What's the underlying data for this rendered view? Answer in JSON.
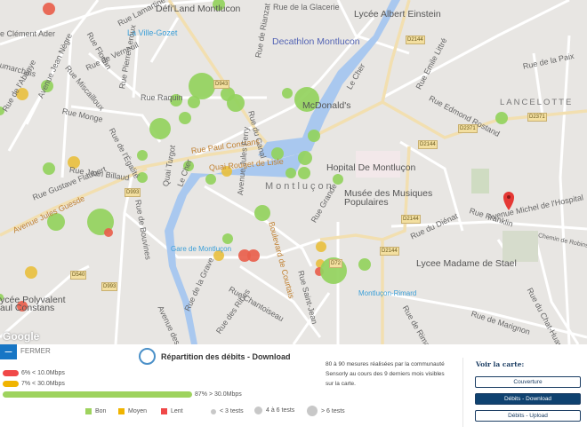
{
  "map": {
    "labels": {
      "defiland": "Défi'Land Montlucon",
      "rue_glacerie": "Rue de la Glacerie",
      "lycee_einstein": "Lycée Albert Einstein",
      "clement_ader": "e Clément Ader",
      "rue_lamartine": "Rue Lamartine",
      "ville_gozet": "La Ville-Gozet",
      "decathlon": "Decathlon Montlucon",
      "rue_florian": "Rue Florian",
      "rue_verneuil": "Rue de Verneuil",
      "rue_pierre_leroux": "Rue Pierre Leroux",
      "rue_rianzat": "Rue de Rianzat",
      "rue_miscailloux": "Rue Miscailloux",
      "av_jean_negre": "Avenue Jean Nègre",
      "beaumarchais": "umarchais",
      "rue_abbaye": "Rue de l'Abbaye",
      "rue_raquin": "Rue Raquin",
      "rue_monge": "Rue Monge",
      "rue_egalite": "Rue de l'Égalité",
      "rue_canal": "Rue du Canal",
      "mcdonalds": "McDonald's",
      "le_cher_top": "Le Cher",
      "rue_emile_littre": "Rue Emile Littré",
      "rue_paix": "Rue de la Paix",
      "rue_edmond_rostand": "Rue Edmond Rostand",
      "lancelotte": "LANCELOTTE",
      "rue_paul_constans": "Rue Paul Constans",
      "quai_rouget": "Quai Rouget de Lisle",
      "rue_jean_billaud": "Rue Jean Billaud",
      "rue_gustave_flaubert": "Rue Gustave Flaubert",
      "hopital": "Hopital De Montluçon",
      "montlucon": "Montluçon",
      "musee": "Musée des Musiques",
      "musee2": "Populaires",
      "av_jules_guesde": "Avenue Jules Guesde",
      "rue_bouvines": "Rue de Bouvines",
      "quai_turgot": "Quai Turgot",
      "le_cher": "Le Cher",
      "av_jules_ferry": "Avenue Jules Ferry",
      "bd_courtais": "Boulevard de Courtais",
      "rue_grande": "Rue Grande",
      "rue_franklin": "Rue Franklin",
      "av_michel_hospital": "Avenue Michel de l'Hospital",
      "chemin_robinson": "Chemin de Robinson",
      "rue_dienat": "Rue du Diénat",
      "gare": "Gare de Montluçon",
      "lycee_stael": "Lycee Madame de Stael",
      "lycee_polyvalent": "ycée Polyvalent",
      "paul_constans": "aul Constans",
      "rue_chantoiseau": "Rue Chantoiseau",
      "rue_grave": "Rue de la Grave",
      "rue_ribes": "Rue des Ribes",
      "rue_saint_jean": "Rue Saint-Jean",
      "rimard": "Montluçon-Rimard",
      "rue_rimard": "Rue de Rimard",
      "rue_marignon": "Rue de Marignon",
      "rue_chat_huant": "Rue du Chat-Huant",
      "av_guesde_south": "Avenue des Guesde"
    },
    "shields": {
      "d943": "D943",
      "d2144a": "D2144",
      "d2144b": "D2144",
      "d2144c": "D2144",
      "d2144d": "D2144",
      "d2371a": "D2371",
      "d2371b": "D2371",
      "d993a": "D993",
      "d993b": "D993",
      "d540": "D540",
      "d72": "D72"
    },
    "attribution": "Google"
  },
  "panel": {
    "close_label": "FERMER",
    "title": "Répartition des débits - Download",
    "bars": [
      {
        "label": "6% < 10.0Mbps",
        "percent": 6,
        "color": "#f04848"
      },
      {
        "label": "7% < 30.0Mbps",
        "percent": 7,
        "color": "#f0b400"
      },
      {
        "label": "87% > 30.0Mbps",
        "percent": 87,
        "color": "#9ed35e"
      }
    ],
    "legend": {
      "good": "Bon",
      "medium": "Moyen",
      "slow": "Lent",
      "small": "< 3 tests",
      "mid": "4 à 6 tests",
      "large": "> 6 tests"
    },
    "colors": {
      "good": "#9ed35e",
      "medium": "#f0b400",
      "slow": "#f04848"
    },
    "description": "80 à 90 mesures réalisées par la communauté Sensorly au cours des 9 derniers mois visibles sur la carte.",
    "voir_label": "Voir la carte:",
    "buttons": [
      "Couverture",
      "Débits - Download",
      "Débits - Upload"
    ]
  }
}
